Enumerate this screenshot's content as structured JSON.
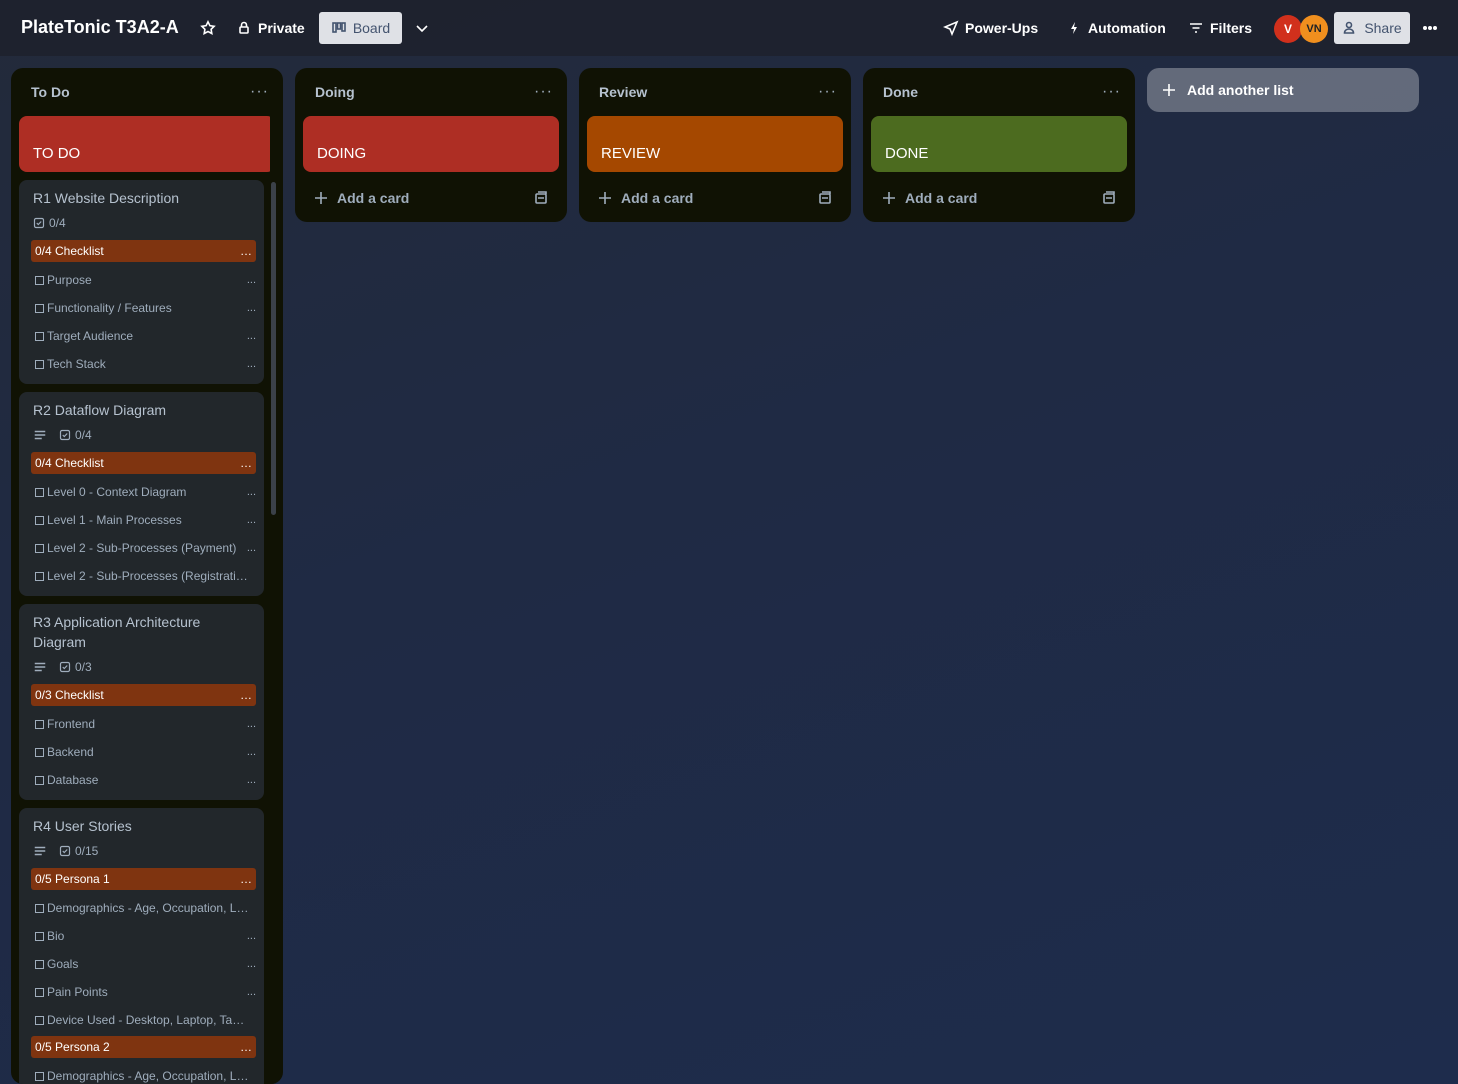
{
  "header": {
    "board_title": "PlateTonic T3A2-A",
    "visibility": "Private",
    "view": "Board",
    "powerups": "Power-Ups",
    "automation": "Automation",
    "filters": "Filters",
    "avatars": [
      "V",
      "VN"
    ],
    "share": "Share"
  },
  "lists": {
    "todo": {
      "title": "To Do",
      "cover": "TO DO",
      "cover_color": "#ae2e24"
    },
    "doing": {
      "title": "Doing",
      "cover": "DOING",
      "cover_color": "#ae2e24",
      "add_card": "Add a card"
    },
    "review": {
      "title": "Review",
      "cover": "REVIEW",
      "cover_color": "#a54800",
      "add_card": "Add a card"
    },
    "done": {
      "title": "Done",
      "cover": "DONE",
      "cover_color": "#4c6b1f",
      "add_card": "Add a card"
    }
  },
  "add_list": "Add another list",
  "cards": [
    {
      "title": "R1 Website Description",
      "checklist_badge": "0/4",
      "checklists": [
        {
          "head": "0/4 Checklist",
          "items": [
            "Purpose",
            "Functionality / Features",
            "Target Audience",
            "Tech Stack"
          ]
        }
      ]
    },
    {
      "title": "R2 Dataflow Diagram",
      "checklist_badge": "0/4",
      "checklists": [
        {
          "head": "0/4 Checklist",
          "items": [
            "Level 0 - Context Diagram",
            "Level 1 - Main Processes",
            "Level 2 - Sub-Processes (Payment)",
            "Level 2 - Sub-Processes (Registration..."
          ]
        }
      ]
    },
    {
      "title_line1": "R3 Application Architecture",
      "title_line2": "Diagram",
      "checklist_badge": "0/3",
      "checklists": [
        {
          "head": "0/3 Checklist",
          "items": [
            "Frontend",
            "Backend",
            "Database"
          ]
        }
      ]
    },
    {
      "title": "R4 User Stories",
      "checklist_badge": "0/15",
      "checklists": [
        {
          "head": "0/5 Persona 1",
          "items": [
            "Demographics - Age, Occupation, Lo...",
            "Bio",
            "Goals",
            "Pain Points",
            "Device Used - Desktop, Laptop, Tabl..."
          ]
        },
        {
          "head": "0/5 Persona 2",
          "items": [
            "Demographics - Age, Occupation, Lo..."
          ]
        }
      ]
    }
  ],
  "colors": {
    "checklist_head": "#7f3410",
    "card_bg": "#22272b",
    "list_bg": "#101204"
  }
}
